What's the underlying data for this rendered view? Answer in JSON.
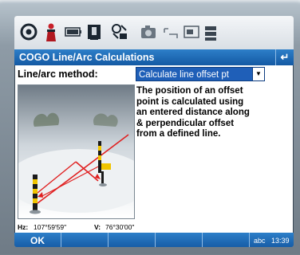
{
  "window": {
    "title": "COGO Line/Arc Calculations",
    "back_icon": "↵"
  },
  "toolbar": {
    "icons": [
      "headset-icon",
      "surveyor-icon",
      "battery-icon",
      "instrument-icon",
      "satellite-icon",
      "camera-icon",
      "measure-icon",
      "card-icon",
      "signal-icon"
    ]
  },
  "form": {
    "method_label": "Line/arc method:",
    "method_value": "Calculate line offset pt",
    "description": [
      "The position of an offset",
      "point is calculated using",
      "an entered distance along",
      "& perpendicular offset",
      "from a defined line."
    ]
  },
  "status": {
    "hz_label": "Hz:",
    "hz_value": "107°59'59\"",
    "v_label": "V:",
    "v_value": "76°30'00\""
  },
  "softkeys": {
    "ok_label": "OK",
    "input_mode": "abc",
    "time": "13:39"
  },
  "colors": {
    "accent": "#1f6fc0",
    "selected": "#1f5fb8",
    "offset_line": "#e02020"
  }
}
